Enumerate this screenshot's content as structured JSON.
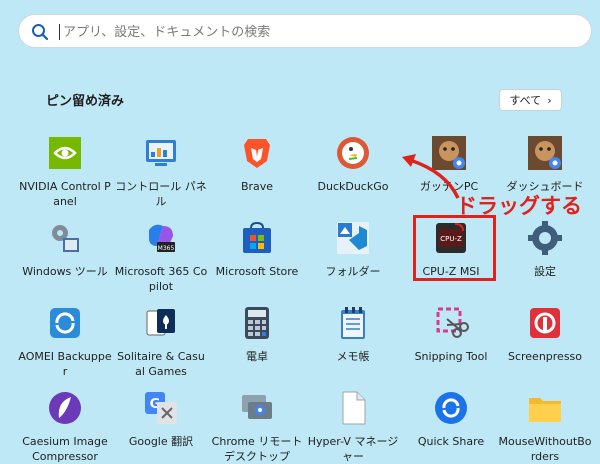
{
  "search": {
    "placeholder": "アプリ、設定、ドキュメントの検索"
  },
  "pinned": {
    "title": "ピン留め済み",
    "all_button": "すべて",
    "all_chevron": "›"
  },
  "apps": [
    {
      "id": "nvidia",
      "label": "NVIDIA Control Panel"
    },
    {
      "id": "control-panel",
      "label": "コントロール パネル"
    },
    {
      "id": "brave",
      "label": "Brave"
    },
    {
      "id": "duckduckgo",
      "label": "DuckDuckGo"
    },
    {
      "id": "gattenpc",
      "label": "ガッテンPC"
    },
    {
      "id": "dash-board",
      "label": "ダッシュボード"
    },
    {
      "id": "windows-tools",
      "label": "Windows ツール"
    },
    {
      "id": "m365",
      "label": "Microsoft 365 Copilot"
    },
    {
      "id": "ms-store",
      "label": "Microsoft Store"
    },
    {
      "id": "folder",
      "label": "フォルダー"
    },
    {
      "id": "cpuz",
      "label": "CPU-Z MSI"
    },
    {
      "id": "settings",
      "label": "設定"
    },
    {
      "id": "aomei",
      "label": "AOMEI Backupper"
    },
    {
      "id": "solitaire",
      "label": "Solitaire & Casual Games"
    },
    {
      "id": "calculator",
      "label": "電卓"
    },
    {
      "id": "notepad",
      "label": "メモ帳"
    },
    {
      "id": "snipping",
      "label": "Snipping Tool"
    },
    {
      "id": "screenpresso",
      "label": "Screenpresso"
    },
    {
      "id": "caesium",
      "label": "Caesium Image Compressor"
    },
    {
      "id": "gtranslate",
      "label": "Google 翻訳"
    },
    {
      "id": "chrome-rd",
      "label": "Chrome リモート デスクトップ"
    },
    {
      "id": "hyperv",
      "label": "Hyper-V マネージャー"
    },
    {
      "id": "quickshare",
      "label": "Quick Share"
    },
    {
      "id": "mwb",
      "label": "MouseWithoutBorders"
    }
  ],
  "annotation": {
    "drag_text": "ドラッグする",
    "color": "#e0221b"
  },
  "cpuz_icon_text": "CPU-Z"
}
